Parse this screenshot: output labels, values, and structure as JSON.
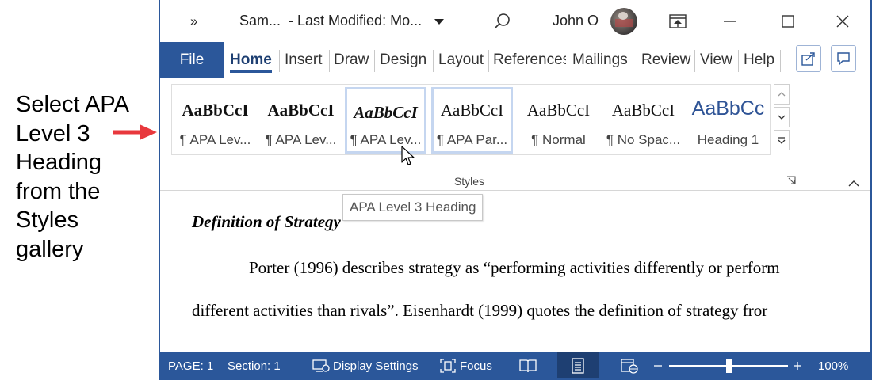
{
  "callout": {
    "lines": [
      "Select APA",
      "Level 3",
      "Heading",
      "from the",
      "Styles",
      "gallery"
    ],
    "arrow_color": "#e8383d"
  },
  "titlebar": {
    "overflow_label": "»",
    "doc_title": "Sam...  - Last Modified: Mo...",
    "search_icon": "search-icon",
    "user_name": "John O",
    "restore_icon": "ribbon-display-icon"
  },
  "tabs": {
    "file": "File",
    "items": [
      "Home",
      "Insert",
      "Draw",
      "Design",
      "Layout",
      "References",
      "Mailings",
      "Review",
      "View",
      "Help"
    ]
  },
  "styles_gallery": {
    "group_label": "Styles",
    "items": [
      {
        "sample": "AaBbCcI",
        "label": "¶ APA Lev..."
      },
      {
        "sample": "AaBbCcI",
        "label": "¶ APA Lev..."
      },
      {
        "sample": "AaBbCcI",
        "label": "¶ APA Lev..."
      },
      {
        "sample": "AaBbCcI",
        "label": "¶ APA Par..."
      },
      {
        "sample": "AaBbCcI",
        "label": "¶ Normal"
      },
      {
        "sample": "AaBbCcI",
        "label": "¶ No Spac..."
      },
      {
        "sample": "AaBbCc",
        "label": "Heading 1"
      }
    ],
    "selected_index": 2
  },
  "tooltip": "APA Level 3 Heading",
  "document": {
    "heading": "Definition of Strategy",
    "para_line1": "Porter (1996) describes strategy as “performing activities differently or perform",
    "para_line2": "different activities than rivals”. Eisenhardt (1999) quotes the definition of strategy fror"
  },
  "statusbar": {
    "page": "PAGE: 1",
    "section": "Section: 1",
    "display_settings": "Display Settings",
    "focus": "Focus",
    "zoom": "100%",
    "zoom_level": 1.0
  },
  "colors": {
    "accent": "#2b579a",
    "accent_dark": "#1e3f72"
  }
}
